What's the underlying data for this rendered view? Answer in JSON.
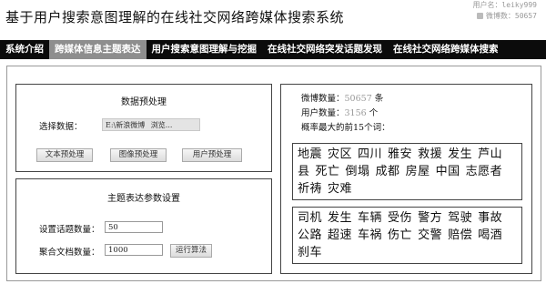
{
  "page": {
    "title": "基于用户搜索意图理解的在线社交网络跨媒体搜索系统"
  },
  "user": {
    "name_label": "用户名：",
    "name": "leiky999",
    "count_label": "微博数：",
    "count": "50657"
  },
  "nav": {
    "tabs": [
      {
        "label": "系统介绍",
        "active": false
      },
      {
        "label": "跨媒体信息主题表达",
        "active": true
      },
      {
        "label": "用户搜索意图理解与挖掘",
        "active": false
      },
      {
        "label": "在线社交网络突发话题发现",
        "active": false
      },
      {
        "label": "在线社交网络跨媒体搜索",
        "active": false
      }
    ]
  },
  "preprocess": {
    "heading": "数据预处理",
    "select_label": "选择数据：",
    "file_value": "E:\\新浪微博",
    "browse_label": "浏览...",
    "buttons": [
      "文本预处理",
      "图像预处理",
      "用户预处理"
    ]
  },
  "topic_params": {
    "heading": "主题表达参数设置",
    "topic_count_label": "设置话题数量：",
    "topic_count_value": "50",
    "doc_count_label": "聚合文档数量：",
    "doc_count_value": "1000",
    "run_label": "运行算法"
  },
  "stats": {
    "weibo_label": "微博数量：",
    "weibo_value": "50657",
    "weibo_unit": "条",
    "user_label": "用户数量：",
    "user_value": "3156",
    "user_unit": "个",
    "top_words_label": "概率最大的前15个词：",
    "topic1_words": [
      "地震",
      "灾区",
      "四川",
      "雅安",
      "救援",
      "发生",
      "芦山",
      "县",
      "死亡",
      "倒塌",
      "成都",
      "房屋",
      "中国",
      "志愿者",
      "祈祷",
      "灾难"
    ],
    "topic2_words": [
      "司机",
      "发生",
      "车辆",
      "受伤",
      "警方",
      "驾驶",
      "事故",
      "公路",
      "超速",
      "车祸",
      "伤亡",
      "交警",
      "赔偿",
      "喝酒",
      "刹车"
    ]
  }
}
